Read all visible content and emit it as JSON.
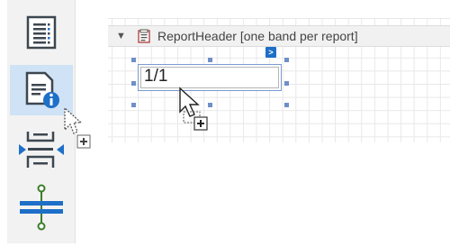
{
  "toolbox": {
    "items": [
      {
        "name": "table-of-contents"
      },
      {
        "name": "page-info"
      },
      {
        "name": "page-break"
      },
      {
        "name": "cross-band-line"
      }
    ],
    "selected_index": 1
  },
  "band": {
    "toggle_glyph": "▼",
    "title": "ReportHeader [one band per report]"
  },
  "smart_tag": {
    "glyph": ">"
  },
  "label": {
    "text": "1/1"
  },
  "colors": {
    "accent": "#1e6fc8",
    "selected_tool_bg": "#cfe2f6",
    "handle": "#6f8fc9"
  }
}
